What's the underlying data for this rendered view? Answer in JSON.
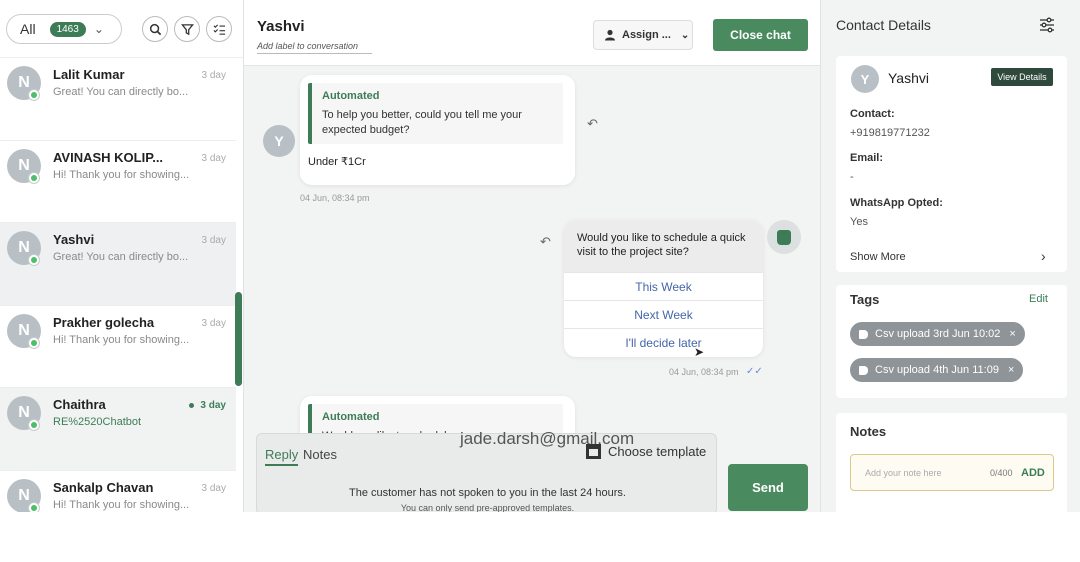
{
  "left_panel": {
    "filter_label": "All",
    "filter_count": "1463",
    "icons": [
      "search-icon",
      "filter-icon",
      "checklist-icon"
    ],
    "conversations": [
      {
        "initial": "N",
        "name": "Lalit Kumar",
        "preview": "Great! You can directly bo...",
        "time": "3 day"
      },
      {
        "initial": "N",
        "name": "AVINASH KOLIP...",
        "preview": "Hi! Thank you for showing...",
        "time": "3 day"
      },
      {
        "initial": "N",
        "name": "Yashvi",
        "preview": "Great! You can directly bo...",
        "time": "3 day"
      },
      {
        "initial": "N",
        "name": "Prakher golecha",
        "preview": "Hi! Thank you for showing...",
        "time": "3 day"
      },
      {
        "initial": "N",
        "name": "Chaithra",
        "preview": "RE%2520Chatbot",
        "time": "3 day"
      },
      {
        "initial": "N",
        "name": "Sankalp Chavan",
        "preview": "Hi! Thank you for showing...",
        "time": "3 day"
      }
    ]
  },
  "chat": {
    "title": "Yashvi",
    "label_placeholder": "Add label to conversation",
    "assign_label": "Assign ...",
    "close_label": "Close chat",
    "msg1": {
      "quote_header": "Automated",
      "quote_text": "To help you better, could you tell me your expected budget?",
      "body": "Under ₹1Cr",
      "avatar": "Y",
      "time": "04 Jun, 08:34 pm"
    },
    "msg2": {
      "question": "Would you like to schedule a quick visit to the project site?",
      "options": [
        "This Week",
        "Next Week",
        "I'll decide later"
      ],
      "time": "04 Jun, 08:34 pm"
    },
    "msg3": {
      "quote_header": "Automated",
      "quote_text": "Would you like to schedule..."
    },
    "composer": {
      "tab_reply": "Reply",
      "tab_notes": "Notes",
      "overlay_email": "jade.darsh@gmail.com",
      "template_label": "Choose template",
      "warning": "The customer has not spoken to you in the last 24 hours.",
      "warning_sub": "You can only send pre-approved templates."
    },
    "send_label": "Send"
  },
  "right_panel": {
    "title": "Contact Details",
    "contact": {
      "initial": "Y",
      "name": "Yashvi",
      "view_label": "View Details",
      "contact_label": "Contact:",
      "contact_value": "+919819771232",
      "email_label": "Email:",
      "email_value": "-",
      "whatsapp_label": "WhatsApp Opted:",
      "whatsapp_value": "Yes",
      "show_more": "Show More"
    },
    "tags": {
      "title": "Tags",
      "edit": "Edit",
      "items": [
        "Csv upload 3rd Jun 10:02",
        "Csv upload 4th Jun 11:09"
      ]
    },
    "notes": {
      "title": "Notes",
      "placeholder": "Add your note here",
      "counter": "0/400",
      "add_label": "ADD"
    }
  },
  "colors": {
    "accent": "#3d7c57",
    "primary_button": "#4a8a5f",
    "link_blue": "#4466aa"
  }
}
